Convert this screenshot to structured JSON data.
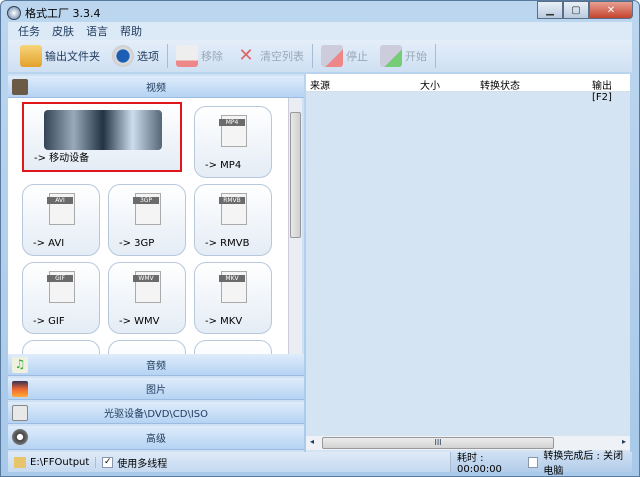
{
  "title": "格式工厂 3.3.4",
  "menu": [
    "任务",
    "皮肤",
    "语言",
    "帮助"
  ],
  "toolbar": {
    "output_folder": "输出文件夹",
    "options": "选项",
    "remove": "移除",
    "clear_list": "清空列表",
    "stop": "停止",
    "start": "开始"
  },
  "categories": {
    "video": "视频",
    "audio": "音频",
    "image": "图片",
    "disc": "光驱设备\\DVD\\CD\\ISO",
    "advanced": "高级"
  },
  "tiles": [
    {
      "label": "-> 移动设备",
      "icon": ""
    },
    {
      "label": "-> MP4",
      "icon": "MP4"
    },
    {
      "label": "-> AVI",
      "icon": "AVI"
    },
    {
      "label": "-> 3GP",
      "icon": "3GP"
    },
    {
      "label": "-> RMVB",
      "icon": "RMVB"
    },
    {
      "label": "-> GIF",
      "icon": "GIF"
    },
    {
      "label": "-> WMV",
      "icon": "WMV"
    },
    {
      "label": "-> MKV",
      "icon": "MKV"
    }
  ],
  "table_headers": {
    "source": "来源",
    "size": "大小",
    "status": "转换状态",
    "output": "输出 [F2]"
  },
  "status": {
    "folder": "E:\\FFOutput",
    "multithread": "使用多线程",
    "multithread_checked": "✓",
    "elapsed": "耗时 : 00:00:00",
    "after": "转换完成后 : 关闭电脑"
  },
  "scroll_grip": "III"
}
